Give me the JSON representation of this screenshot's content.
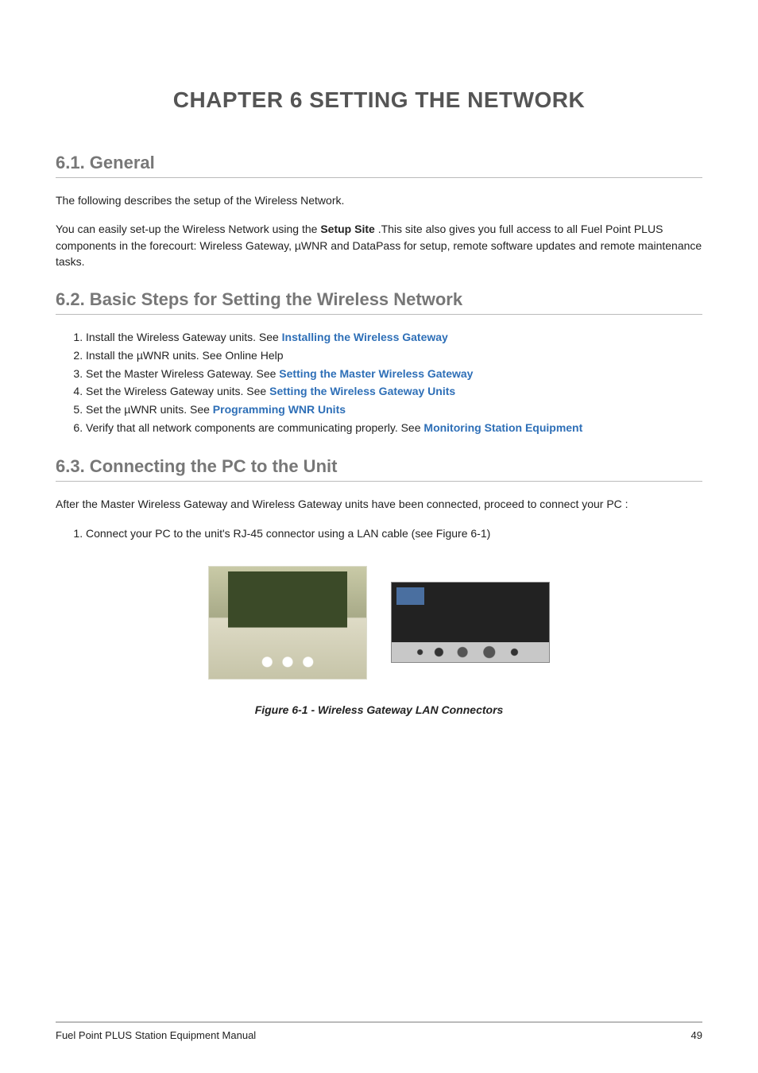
{
  "chapter": {
    "title": "CHAPTER 6  SETTING THE NETWORK"
  },
  "sections": {
    "s61": {
      "heading": "6.1. General",
      "p1": "The following describes the setup of the Wireless Network.",
      "p2_a": "You can easily set-up the Wireless Network using the ",
      "p2_bold": "Setup Site",
      "p2_b": ".This site also gives you full access to all Fuel Point PLUS components in the forecourt: Wireless Gateway, µWNR and DataPass for setup, remote software updates and remote maintenance tasks."
    },
    "s62": {
      "heading": "6.2. Basic Steps for Setting the Wireless Network",
      "items": [
        {
          "pre": "Install the Wireless Gateway units. See ",
          "link": "Installing the Wireless Gateway",
          "post": ""
        },
        {
          "pre": "Install the µWNR units. See Online Help",
          "link": "",
          "post": ""
        },
        {
          "pre": "Set the Master Wireless Gateway. See ",
          "link": "Setting the Master Wireless Gateway",
          "post": ""
        },
        {
          "pre": "Set the Wireless Gateway units. See ",
          "link": "Setting the Wireless Gateway Units",
          "post": ""
        },
        {
          "pre": "Set the µWNR units. See ",
          "link": "Programming WNR Units",
          "post": ""
        },
        {
          "pre": "Verify that all network components are communicating properly. See ",
          "link": "Monitoring Station Equipment",
          "post": ""
        }
      ]
    },
    "s63": {
      "heading": "6.3. Connecting the PC to the Unit",
      "p1": "After the Master Wireless Gateway and Wireless Gateway units have been connected, proceed to connect your PC :",
      "steps": [
        "Connect your PC to the unit's RJ-45 connector using a LAN cable (see Figure 6-1)"
      ],
      "figure_caption": "Figure 6-1 - Wireless Gateway LAN Connectors"
    }
  },
  "footer": {
    "left": "Fuel Point PLUS Station Equipment Manual",
    "right": "49"
  }
}
